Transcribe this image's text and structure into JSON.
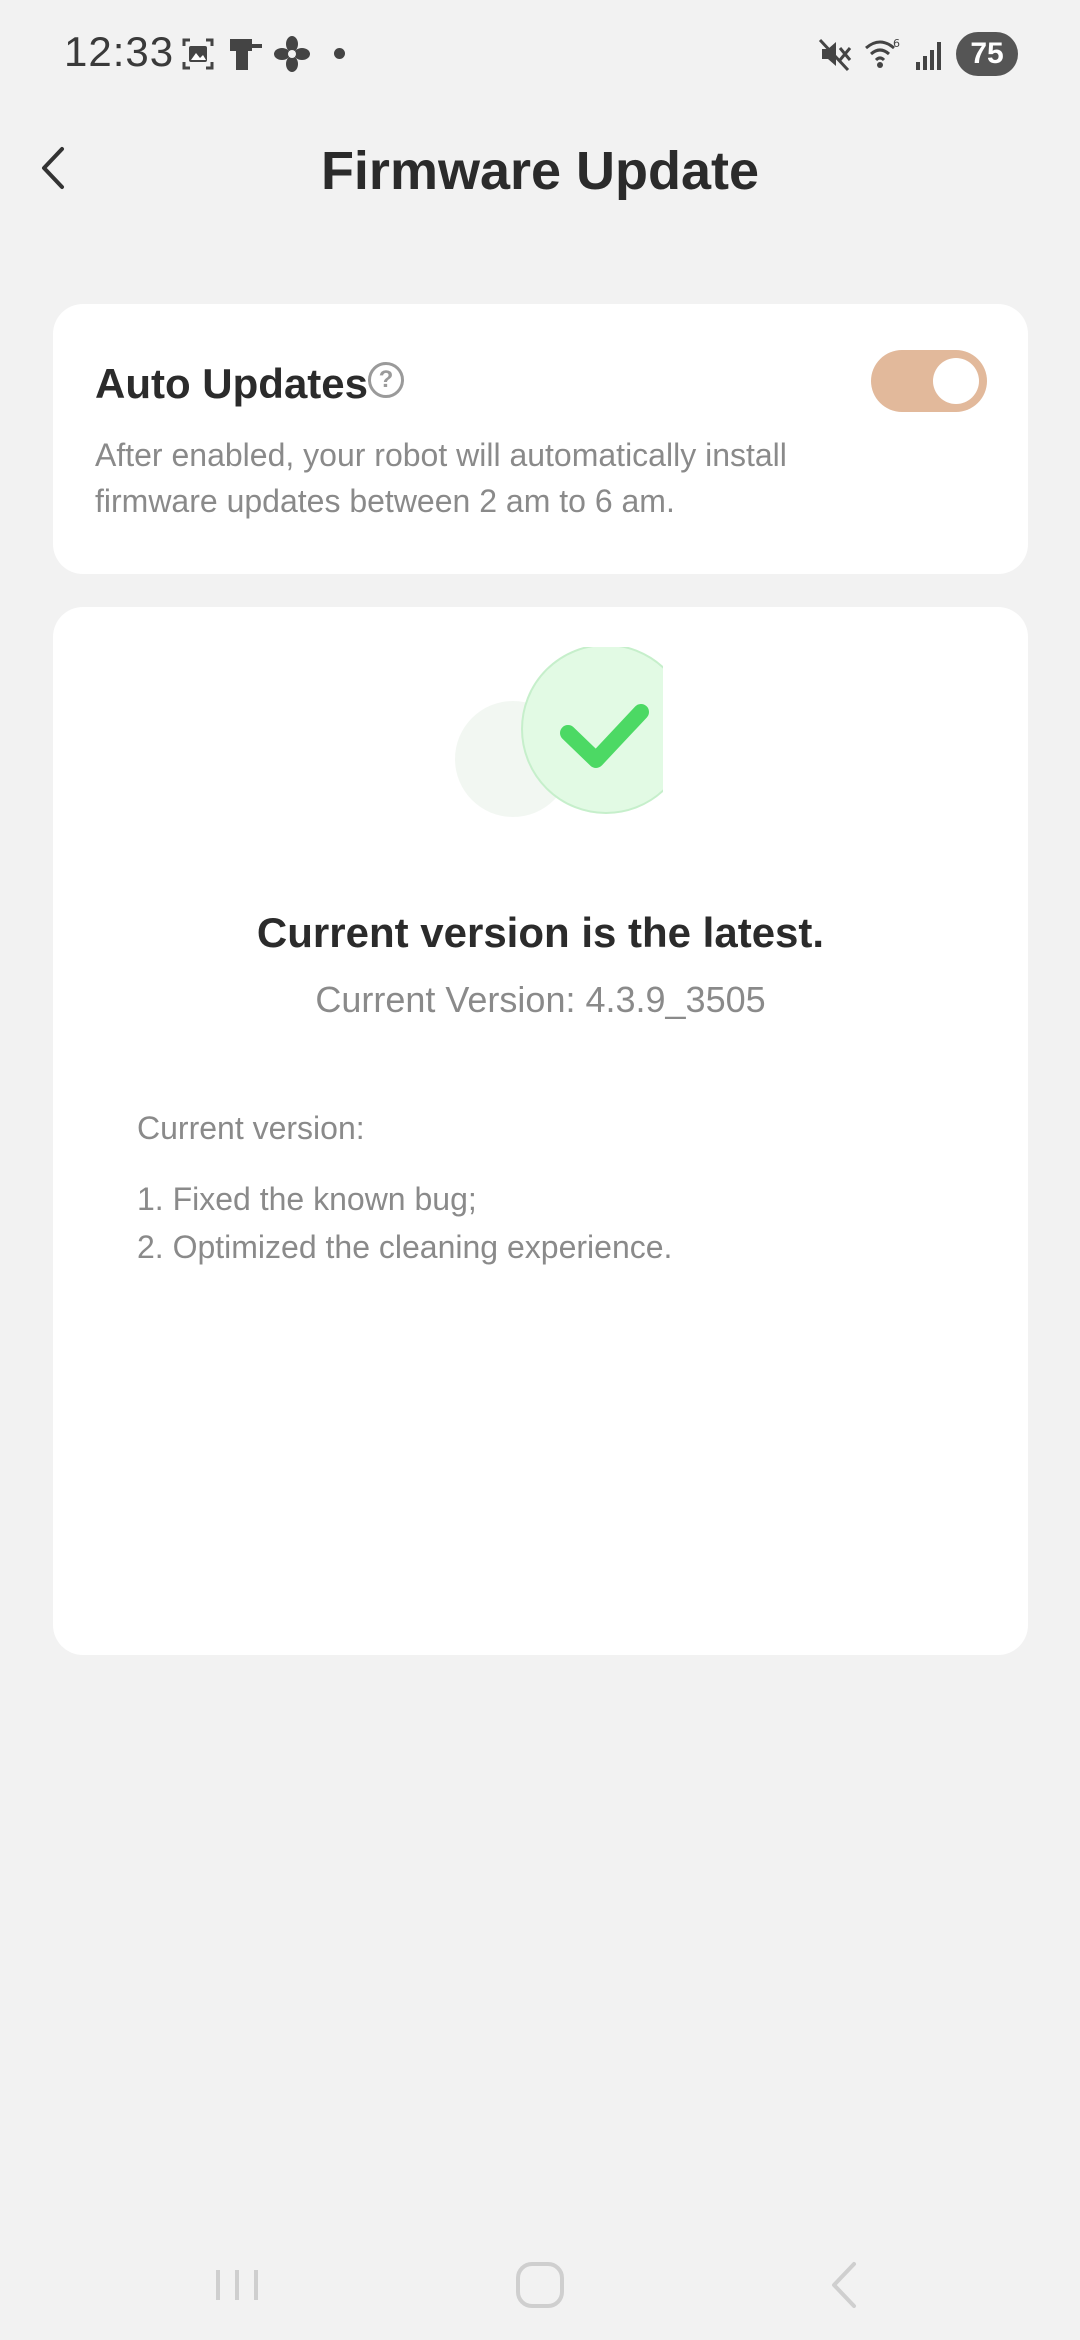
{
  "status_bar": {
    "time": "12:33",
    "battery": "75",
    "icons": [
      "gallery-icon",
      "phone-icon",
      "fan-icon",
      "notification-dot",
      "mute-icon",
      "wifi-icon",
      "signal-icon"
    ]
  },
  "header": {
    "title": "Firmware Update",
    "back_icon": "chevron-left-icon"
  },
  "auto_updates": {
    "title": "Auto Updates",
    "help_symbol": "?",
    "description": "After enabled, your robot will automatically install firmware updates between 2 am to 6 am.",
    "enabled": true,
    "toggle_color": "#e2b99b"
  },
  "version_card": {
    "status_icon": "check-circle-icon",
    "status_title": "Current version is the latest.",
    "current_version": "Current Version: 4.3.9_3505",
    "notes_heading": "Current version:",
    "notes": [
      "1. Fixed the known bug;",
      "2. Optimized the cleaning experience."
    ],
    "check_color": "#4cd964"
  },
  "nav_bar": {
    "buttons": [
      "recent-apps-icon",
      "home-icon",
      "back-icon"
    ]
  }
}
